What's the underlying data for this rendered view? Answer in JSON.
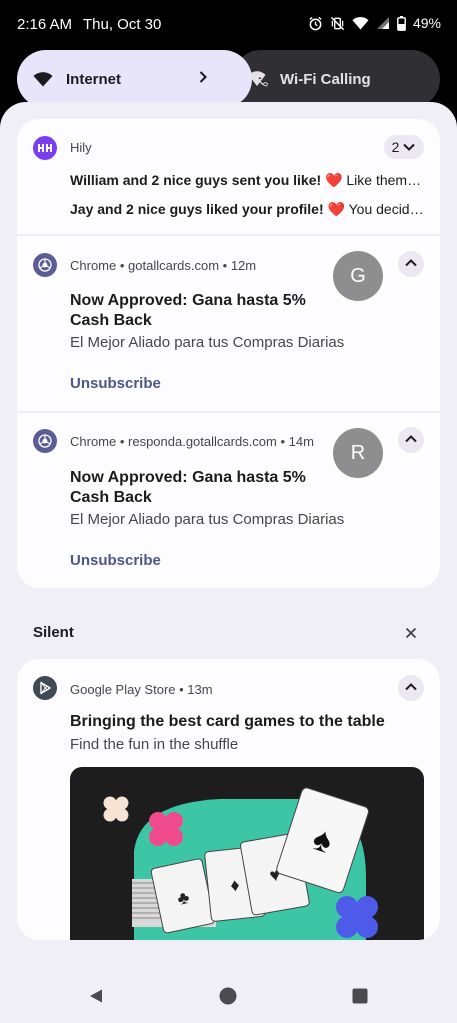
{
  "status_bar": {
    "time": "2:16 AM",
    "date": "Thu, Oct 30",
    "battery": "49%",
    "icons": [
      "alarm-icon",
      "vibrate-off-icon",
      "wifi-icon",
      "signal-icon",
      "battery-icon"
    ]
  },
  "quick_settings": {
    "internet": {
      "label": "Internet",
      "icon": "wifi-icon"
    },
    "wifi_calling": {
      "label": "Wi-Fi Calling",
      "icon": "wifi-calling-icon"
    }
  },
  "notifications": [
    {
      "app": "Hily",
      "count": "2",
      "messages": [
        {
          "bold": "William and 2 nice guys sent you like! ",
          "emoji": "❤️",
          "rest": " Like them…"
        },
        {
          "bold": "Jay and 2 nice guys liked your profile! ",
          "emoji": "❤️",
          "rest": " You decid…"
        }
      ]
    },
    {
      "header": "Chrome • gotallcards.com • 12m",
      "avatar_letter": "G",
      "title": "Now Approved: Gana hasta 5% Cash Back",
      "text": "El Mejor Aliado para tus Compras Diarias",
      "action": "Unsubscribe"
    },
    {
      "header": "Chrome • responda.gotallcards.com • 14m",
      "avatar_letter": "R",
      "title": "Now Approved: Gana hasta 5% Cash Back",
      "text": "El Mejor Aliado para tus Compras Diarias",
      "action": "Unsubscribe"
    }
  ],
  "silent_section": {
    "label": "Silent",
    "notification": {
      "header": "Google Play Store • 13m",
      "title": "Bringing the best card games to the table",
      "text": "Find the fun in the shuffle"
    }
  },
  "colors": {
    "shade_background": "#f0eef6",
    "card_background": "#fdfcff",
    "accent_link": "#515689",
    "internet_tile": "#e8e4fa",
    "wifi_calling_tile": "#303034"
  }
}
